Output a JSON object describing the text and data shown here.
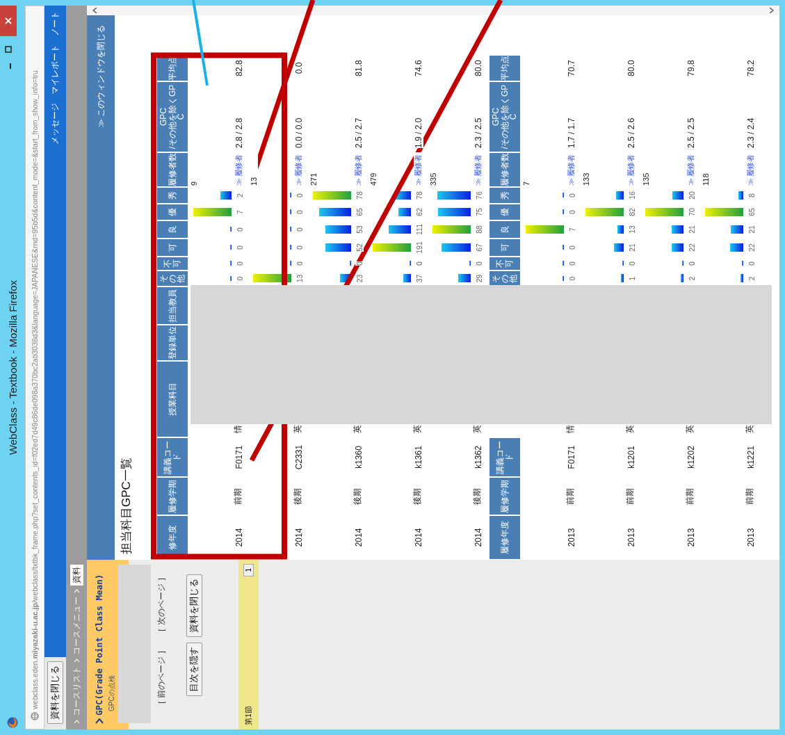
{
  "window": {
    "title": "WebClass - Textbook - Mozilla Firefox"
  },
  "address_bar": {
    "url": "webclass.eden.**miyazaki-u.ac.jp**/webclass/txtbk_frame.php?set_contents_id=f02ed7d49c86de098a370bc2ab3038d3&language=JAPANESE&rnd=95b5d&content_mode=&start_from_show_info=tru"
  },
  "top_bar": {
    "close_button": "資料を閉じる",
    "links": [
      "メッセージ",
      "マイレポート",
      "ノート"
    ]
  },
  "breadcrumb": [
    {
      "label": "コースリスト",
      "selected": false
    },
    {
      "label": "コースメニュー",
      "selected": false
    },
    {
      "label": "資料",
      "selected": true
    }
  ],
  "sidebar": {
    "title": "GPC(Grade Point Class Mean)",
    "subtitle": "GPCの点検",
    "page_links": [
      "［ 前のページ ］",
      "［ 次のページ ］"
    ],
    "buttons": [
      "目次を隠す",
      "資料を閉じる"
    ],
    "sections": [
      {
        "label": "第1節",
        "page": "1"
      }
    ]
  },
  "main": {
    "close_link": "≫ このウィンドウを閉じる",
    "heading": "担当科目GPC一覧",
    "tables": [
      {
        "columns_left": [
          "修年度",
          "履修学期",
          "講義コード"
        ],
        "columns_middle": [
          "授業科目",
          "登録単位",
          "担当教員"
        ],
        "columns_right": [
          "その他",
          "不可",
          "可",
          "良",
          "優",
          "秀",
          "履修者数",
          "GPC\n/その他を除くGPC",
          "平均点"
        ],
        "rows": [
          {
            "year": "2014",
            "term": "前期",
            "code": "F0171",
            "subject": "情",
            "counts": [
              "0",
              "0",
              "0",
              "0",
              "7",
              "2"
            ],
            "total": "9",
            "students_link": "≫ 履修者",
            "gpc": "2.8 / 2.8",
            "average": "82.8"
          },
          {
            "year": "2014",
            "term": "後期",
            "code": "C2331",
            "subject": "英",
            "counts": [
              "13",
              "0",
              "0",
              "0",
              "0",
              "0"
            ],
            "total": "13",
            "students_link": "≫ 履修者",
            "gpc": "0.0 / 0.0",
            "average": "0.0"
          },
          {
            "year": "2014",
            "term": "後期",
            "code": "k1360",
            "subject": "英",
            "counts": [
              "23",
              "0",
              "52",
              "53",
              "65",
              "78"
            ],
            "total": "271",
            "students_link": "≫ 履修者",
            "gpc": "2.5 / 2.7",
            "average": "81.8"
          },
          {
            "year": "2014",
            "term": "後期",
            "code": "k1361",
            "subject": "英",
            "counts": [
              "37",
              "0",
              "191",
              "111",
              "62",
              "78"
            ],
            "total": "479",
            "students_link": "≫ 履修者",
            "gpc": "1.9 / 2.0",
            "average": "74.6"
          },
          {
            "year": "2014",
            "term": "後期",
            "code": "k1362",
            "subject": "英",
            "counts": [
              "29",
              "0",
              "67",
              "88",
              "75",
              "76"
            ],
            "total": "335",
            "students_link": "≫ 履修者",
            "gpc": "2.3 / 2.5",
            "average": "80.0"
          }
        ]
      },
      {
        "columns_left": [
          "履修年度",
          "履修学期",
          "講義コード"
        ],
        "columns_right": [
          "その他",
          "不可",
          "可",
          "良",
          "優",
          "秀",
          "履修者数",
          "GPC\n/その他を除くGPC",
          "平均点"
        ],
        "rows": [
          {
            "year": "2013",
            "term": "前期",
            "code": "F0171",
            "subject": "情",
            "counts": [
              "0",
              "0",
              "0",
              "7",
              "0",
              "0"
            ],
            "total": "7",
            "students_link": "≫ 履修者",
            "gpc": "1.7 / 1.7",
            "average": "70.7"
          },
          {
            "year": "2013",
            "term": "前期",
            "code": "k1201",
            "subject": "英",
            "counts": [
              "1",
              "0",
              "21",
              "13",
              "82",
              "16"
            ],
            "total": "133",
            "students_link": "≫ 履修者",
            "gpc": "2.5 / 2.6",
            "average": "80.0"
          },
          {
            "year": "2013",
            "term": "前期",
            "code": "k1202",
            "subject": "英",
            "counts": [
              "2",
              "0",
              "22",
              "21",
              "70",
              "20"
            ],
            "total": "135",
            "students_link": "≫ 履修者",
            "gpc": "2.5 / 2.5",
            "average": "79.8"
          },
          {
            "year": "2013",
            "term": "前期",
            "code": "k1221",
            "subject": "英",
            "counts": [
              "2",
              "0",
              "22",
              "21",
              "65",
              "8"
            ],
            "total": "118",
            "students_link": "≫ 履修者",
            "gpc": "2.3 / 2.4",
            "average": "78.2"
          }
        ]
      }
    ]
  }
}
